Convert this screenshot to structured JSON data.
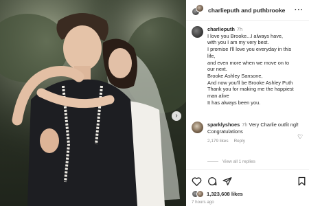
{
  "post": {
    "header": {
      "title": "charlieputh and puthbrooke"
    },
    "caption": {
      "user": "charlieputh",
      "time": "7h",
      "lines": [
        "I love you Brooke...I always have,",
        "with you I am my very best.",
        "I promise I'll love you everyday in this",
        "life,",
        "and even more when we move on to",
        "our next.",
        "Brooke Ashley Sansone,",
        "And now you'll be Brooke Ashley Puth",
        "Thank you for making me the happiest",
        "man alive",
        "It has always been you."
      ]
    },
    "comment": {
      "user": "sparklyshoes",
      "time": "7h",
      "lines": [
        "Very Charlie outfit ngl!",
        "Congratulations"
      ],
      "likes": "2,179 likes",
      "reply_label": "Reply",
      "view_replies": "View all 1 replies"
    },
    "likes": "1,323,608 likes",
    "time_ago": "7 hours ago"
  },
  "icons": {
    "more": "more-options-icon",
    "next": "chevron-right-icon",
    "heart": "heart-icon",
    "comment": "comment-icon",
    "share": "share-icon",
    "save": "bookmark-icon"
  }
}
